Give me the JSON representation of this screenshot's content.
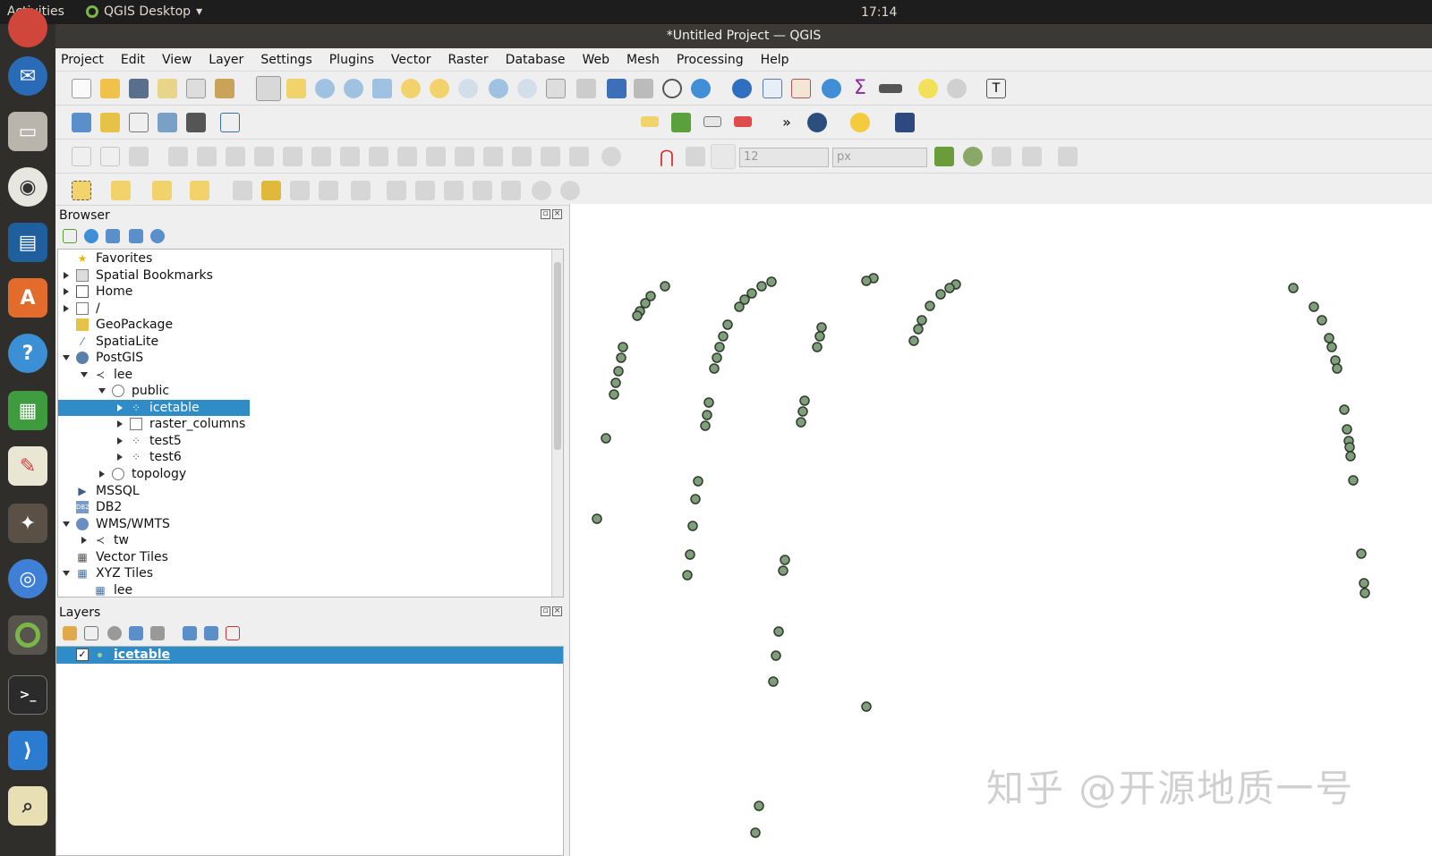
{
  "topbar": {
    "activities": "Activities",
    "app_name": "QGIS Desktop",
    "clock": "17:14"
  },
  "window": {
    "title": "*Untitled Project — QGIS"
  },
  "menu": [
    "Project",
    "Edit",
    "View",
    "Layer",
    "Settings",
    "Plugins",
    "Vector",
    "Raster",
    "Database",
    "Web",
    "Mesh",
    "Processing",
    "Help"
  ],
  "digitizing": {
    "size_value": "12",
    "unit": "px"
  },
  "browser": {
    "title": "Browser",
    "items": [
      {
        "label": "Favorites",
        "icon": "star-icon"
      },
      {
        "label": "Spatial Bookmarks",
        "icon": "bookmark-icon"
      },
      {
        "label": "Home",
        "icon": "home-icon"
      },
      {
        "label": "/",
        "icon": "folder-icon"
      },
      {
        "label": "GeoPackage",
        "icon": "geopackage-icon"
      },
      {
        "label": "SpatiaLite",
        "icon": "spatialite-icon"
      },
      {
        "label": "PostGIS",
        "icon": "postgis-icon"
      },
      {
        "label": "lee",
        "icon": "connection-icon"
      },
      {
        "label": "public",
        "icon": "schema-icon"
      },
      {
        "label": "icetable",
        "icon": "point-layer-icon"
      },
      {
        "label": "raster_columns",
        "icon": "table-icon"
      },
      {
        "label": "test5",
        "icon": "point-layer-icon"
      },
      {
        "label": "test6",
        "icon": "point-layer-icon"
      },
      {
        "label": "topology",
        "icon": "schema-icon"
      },
      {
        "label": "MSSQL",
        "icon": "mssql-icon"
      },
      {
        "label": "DB2",
        "icon": "db2-icon"
      },
      {
        "label": "WMS/WMTS",
        "icon": "globe-icon"
      },
      {
        "label": "tw",
        "icon": "connection-icon"
      },
      {
        "label": "Vector Tiles",
        "icon": "grid-icon"
      },
      {
        "label": "XYZ Tiles",
        "icon": "grid-icon"
      },
      {
        "label": "lee",
        "icon": "grid-icon"
      }
    ]
  },
  "layers": {
    "title": "Layers",
    "items": [
      {
        "label": "icetable",
        "checked": "✓"
      }
    ]
  },
  "watermark": "知乎 @开源地质一号",
  "colors": {
    "selection": "#308cc6",
    "point_fill": "#7f9f7a",
    "point_stroke": "#2e3a2c"
  }
}
